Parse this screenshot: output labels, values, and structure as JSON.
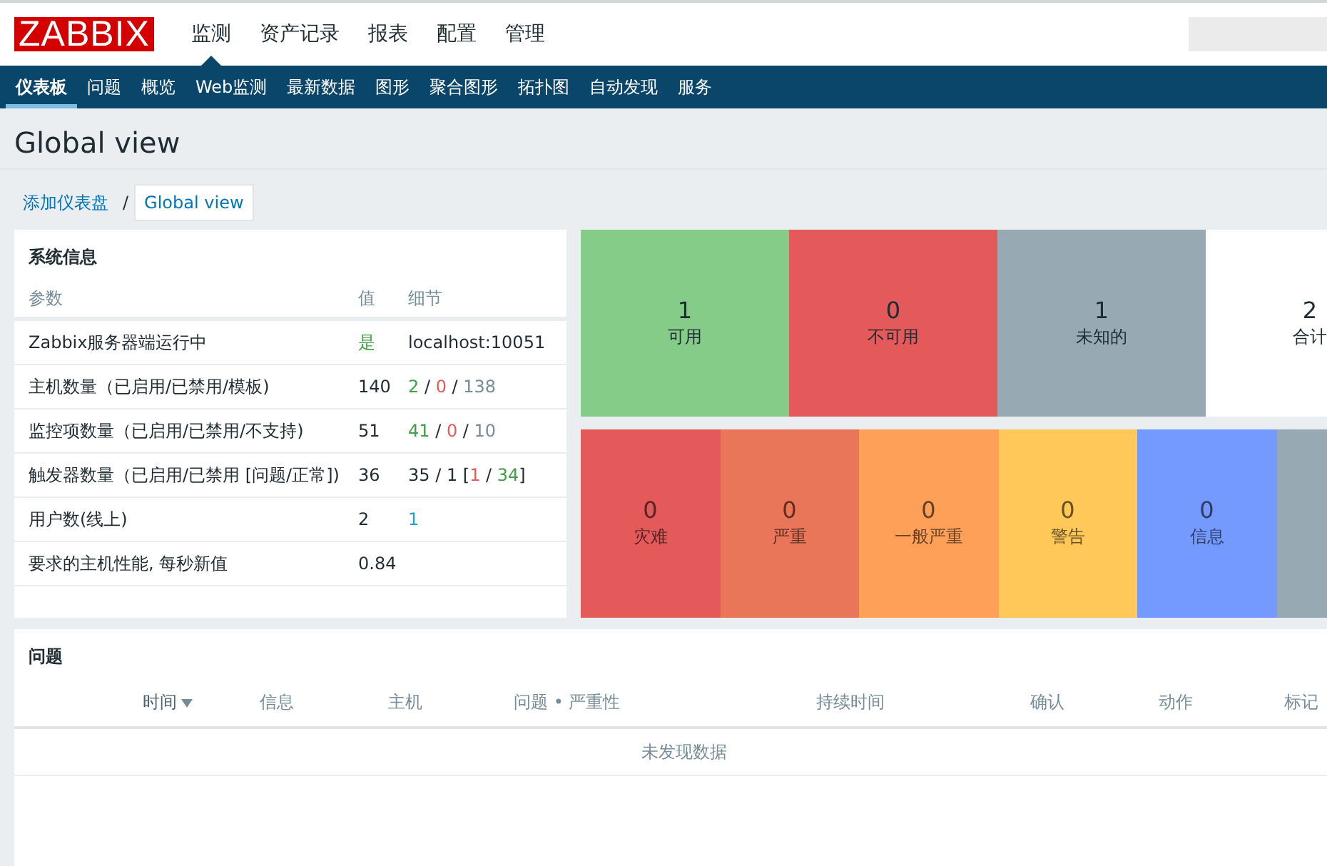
{
  "header": {
    "logo": "ZABBIX",
    "menu": [
      {
        "label": "监测",
        "selected": true
      },
      {
        "label": "资产记录",
        "selected": false
      },
      {
        "label": "报表",
        "selected": false
      },
      {
        "label": "配置",
        "selected": false
      },
      {
        "label": "管理",
        "selected": false
      }
    ]
  },
  "submenu": [
    {
      "label": "仪表板",
      "selected": true
    },
    {
      "label": "问题",
      "selected": false
    },
    {
      "label": "概览",
      "selected": false
    },
    {
      "label": "Web监测",
      "selected": false
    },
    {
      "label": "最新数据",
      "selected": false
    },
    {
      "label": "图形",
      "selected": false
    },
    {
      "label": "聚合图形",
      "selected": false
    },
    {
      "label": "拓扑图",
      "selected": false
    },
    {
      "label": "自动发现",
      "selected": false
    },
    {
      "label": "服务",
      "selected": false
    }
  ],
  "page_title": "Global view",
  "breadcrumbs": [
    {
      "label": "添加仪表盘",
      "selected": false
    },
    {
      "label": "Global view",
      "selected": true
    }
  ],
  "breadcrumb_separator": "/",
  "system_info": {
    "title": "系统信息",
    "columns": [
      "参数",
      "值",
      "细节"
    ],
    "rows": [
      {
        "parameter": "Zabbix服务器端运行中",
        "value": "是",
        "value_ok": true,
        "details": [
          {
            "text": "localhost:10051"
          }
        ]
      },
      {
        "parameter": "主机数量（已启用/已禁用/模板)",
        "value": "140",
        "details": [
          {
            "text": "2",
            "color": "#429e47"
          },
          {
            "text": " / "
          },
          {
            "text": "0",
            "color": "#e45959"
          },
          {
            "text": " / "
          },
          {
            "text": "138",
            "color": "#768d99"
          }
        ]
      },
      {
        "parameter": "监控项数量（已启用/已禁用/不支持)",
        "value": "51",
        "details": [
          {
            "text": "41",
            "color": "#429e47"
          },
          {
            "text": " / "
          },
          {
            "text": "0",
            "color": "#e45959"
          },
          {
            "text": " / "
          },
          {
            "text": "10",
            "color": "#768d99"
          }
        ]
      },
      {
        "parameter": "触发器数量（已启用/已禁用 [问题/正常])",
        "value": "36",
        "details": [
          {
            "text": "35 / 1 ["
          },
          {
            "text": "1",
            "color": "#e45959"
          },
          {
            "text": " / "
          },
          {
            "text": "34",
            "color": "#429e47"
          },
          {
            "text": "]"
          }
        ]
      },
      {
        "parameter": "用户数(线上)",
        "value": "2",
        "details": [
          {
            "text": "1",
            "color": "#1f9ed8"
          }
        ]
      },
      {
        "parameter": "要求的主机性能, 每秒新值",
        "value": "0.84",
        "details": []
      }
    ]
  },
  "host_status": [
    {
      "count": "1",
      "label": "可用",
      "color": "#86cc89"
    },
    {
      "count": "0",
      "label": "不可用",
      "color": "#e45959"
    },
    {
      "count": "1",
      "label": "未知的",
      "color": "#97aab3"
    },
    {
      "count": "2",
      "label": "合计",
      "color": "#ffffff"
    }
  ],
  "severities": [
    {
      "count": "0",
      "label": "灾难",
      "color": "#e45959"
    },
    {
      "count": "0",
      "label": "严重",
      "color": "#e97659"
    },
    {
      "count": "0",
      "label": "一般严重",
      "color": "#ffa059"
    },
    {
      "count": "0",
      "label": "警告",
      "color": "#ffc859"
    },
    {
      "count": "0",
      "label": "信息",
      "color": "#7499ff"
    },
    {
      "color": "#97aab3"
    }
  ],
  "problems": {
    "title": "问题",
    "columns": [
      {
        "label": "时间",
        "sorted": true
      },
      {
        "label": "信息",
        "sorted": false
      },
      {
        "label": "主机",
        "sorted": false
      },
      {
        "label": "问题 • 严重性",
        "sorted": false
      },
      {
        "label": "持续时间",
        "sorted": false
      },
      {
        "label": "确认",
        "sorted": false
      },
      {
        "label": "动作",
        "sorted": false
      },
      {
        "label": "标记",
        "sorted": false
      }
    ],
    "empty_text": "未发现数据"
  }
}
